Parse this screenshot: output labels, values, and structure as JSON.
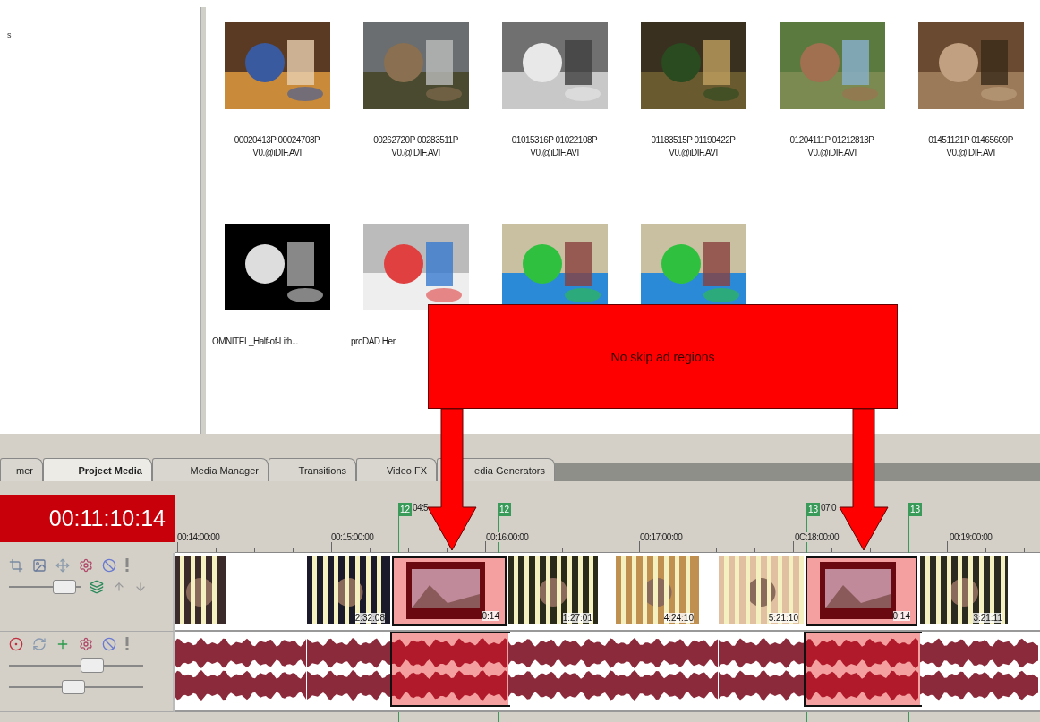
{
  "left_pane": {
    "text": "s"
  },
  "media_items": [
    {
      "name": "00020413P 00024703P V0.@iDIF.AVI",
      "kind": "picture"
    },
    {
      "name": "00262720P 00283511P V0.@iDIF.AVI",
      "kind": "picture"
    },
    {
      "name": "01015316P 01022108P V0.@iDIF.AVI",
      "kind": "picture"
    },
    {
      "name": "01183515P 01190422P V0.@iDIF.AVI",
      "kind": "picture"
    },
    {
      "name": "01204111P 01212813P V0.@iDIF.AVI",
      "kind": "picture"
    },
    {
      "name": "01451121P 01465609P V0.@iDIF.AVI",
      "kind": "picture"
    },
    {
      "name": "OMNITEL_Half-of-Lith...",
      "kind": "picture"
    },
    {
      "name": "proDAD Her",
      "kind": "picture"
    },
    {
      "kind": "picture"
    },
    {
      "kind": "picture"
    }
  ],
  "tabs": [
    {
      "label": "mer",
      "selected": false
    },
    {
      "label": "Project Media",
      "selected": true
    },
    {
      "label": "Media Manager",
      "selected": false
    },
    {
      "label": "Transitions",
      "selected": false
    },
    {
      "label": "Video FX",
      "selected": false
    },
    {
      "label": "edia Generators",
      "selected": false
    }
  ],
  "timecode": "00:11:10:14",
  "markers": [
    {
      "label": "12",
      "time": "04:5"
    },
    {
      "label": "12"
    },
    {
      "label": "13",
      "time": "07:0"
    },
    {
      "label": "13"
    }
  ],
  "ruler": [
    "00:14:00:00",
    "00:15:00:00",
    "00:16:00:00",
    "00:17:00:00",
    "0C:18:00:00",
    "00:19:00:00"
  ],
  "video_track": {
    "level": 0.78,
    "clips": [
      {
        "highlighted": false
      },
      {
        "label": "2:32:08",
        "highlighted": false
      },
      {
        "label": "0:14",
        "highlighted": true
      },
      {
        "label": "1:27:01",
        "highlighted": false
      },
      {
        "label": "4:24:10",
        "highlighted": false
      },
      {
        "label": "5:21:10",
        "highlighted": false
      },
      {
        "label": "0:14",
        "highlighted": true
      },
      {
        "label": "3:21:11",
        "highlighted": false
      }
    ]
  },
  "audio_track": {
    "volume": {
      "level": 0.62
    },
    "pan": {
      "level": 0.48
    }
  },
  "annotation": {
    "text": "No skip ad regions"
  }
}
